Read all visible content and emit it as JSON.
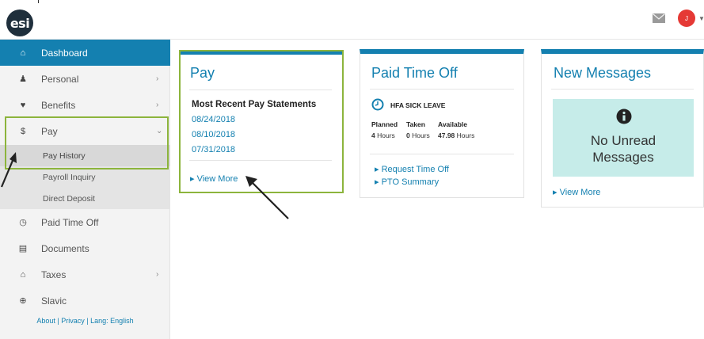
{
  "header": {
    "logo_text": "esi",
    "avatar_initial": "J",
    "icons": {
      "mail": "mail-icon",
      "caret": "caret-down-icon"
    }
  },
  "sidebar": {
    "items": [
      {
        "icon": "home-icon",
        "glyph": "⌂",
        "label": "Dashboard",
        "active": true,
        "chevron": ""
      },
      {
        "icon": "person-icon",
        "glyph": "☺",
        "label": "Personal",
        "chevron": "›"
      },
      {
        "icon": "heart-icon",
        "glyph": "♥",
        "label": "Benefits",
        "chevron": "›"
      },
      {
        "icon": "dollar-icon",
        "glyph": "$",
        "label": "Pay",
        "chevron": "⌄"
      },
      {
        "icon": "clock-icon",
        "glyph": "◷",
        "label": "Paid Time Off",
        "chevron": ""
      },
      {
        "icon": "document-icon",
        "glyph": "▤",
        "label": "Documents",
        "chevron": ""
      },
      {
        "icon": "bank-icon",
        "glyph": "⌂",
        "label": "Taxes",
        "chevron": "›"
      },
      {
        "icon": "globe-icon",
        "glyph": "⊕",
        "label": "Slavic",
        "chevron": ""
      }
    ],
    "pay_subitems": [
      "Pay History",
      "Payroll Inquiry",
      "Direct Deposit"
    ],
    "footer": "About | Privacy | Lang: English"
  },
  "pay_card": {
    "title": "Pay",
    "subtitle": "Most Recent Pay Statements",
    "statements": [
      "08/24/2018",
      "08/10/2018",
      "07/31/2018"
    ],
    "view_more": "View More"
  },
  "pto_card": {
    "title": "Paid Time Off",
    "leave_type": "HFA SICK LEAVE",
    "headers": [
      "Planned",
      "Taken",
      "Available"
    ],
    "planned": {
      "value": "4",
      "unit": "Hours"
    },
    "taken": {
      "value": "0",
      "unit": "Hours"
    },
    "available": {
      "value": "47.98",
      "unit": "Hours"
    },
    "links": [
      "Request Time Off",
      "PTO Summary"
    ]
  },
  "messages_card": {
    "title": "New Messages",
    "empty_text_line1": "No Unread",
    "empty_text_line2": "Messages",
    "view_more": "View More"
  },
  "colors": {
    "primary": "#1480b0",
    "highlight": "#8cb43c",
    "empty_box": "#c6ece9",
    "avatar": "#e53935"
  }
}
